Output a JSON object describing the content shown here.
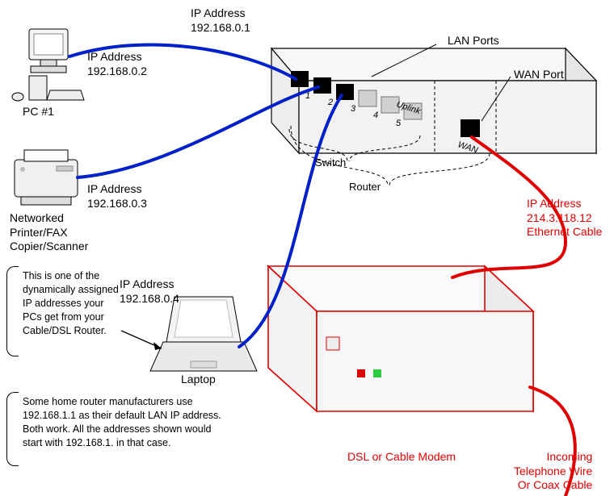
{
  "pc1": {
    "ip_label": "IP Address",
    "ip": "192.168.0.2",
    "name": "PC #1"
  },
  "printer": {
    "ip_label": "IP Address",
    "ip": "192.168.0.3",
    "name": "Networked\nPrinter/FAX\nCopier/Scanner"
  },
  "laptop": {
    "ip_label": "IP Address",
    "ip": "192.168.0.4",
    "name": "Laptop"
  },
  "router": {
    "ip_label": "IP Address",
    "ip": "192.168.0.1",
    "lan_ports_label": "LAN Ports",
    "wan_port_label": "WAN Port",
    "ports": {
      "p1": "1",
      "p2": "2",
      "p3": "3",
      "p4": "4",
      "p5": "5",
      "uplink": "Uplink",
      "wan": "WAN"
    },
    "switch_label": "Switch",
    "router_label": "Router"
  },
  "modem": {
    "name": "DSL or Cable Modem"
  },
  "wan": {
    "ip_label": "IP Address",
    "ip": "214.3.118.12",
    "cable": "Ethernet Cable"
  },
  "incoming": {
    "text": "Incoming\nTelephone Wire\nOr Coax Cable"
  },
  "notes": {
    "dhcp": "This is one of the\ndynamically\nassigned IP\naddresses your\nPCs get from\nyour Cable/DSL\nRouter.",
    "alt_subnet": "Some home router manufacturers\nuse 192.168.1.1 as their default LAN\nIP address. Both work. All the\naddresses shown would start with\n192.168.1. in that case."
  }
}
